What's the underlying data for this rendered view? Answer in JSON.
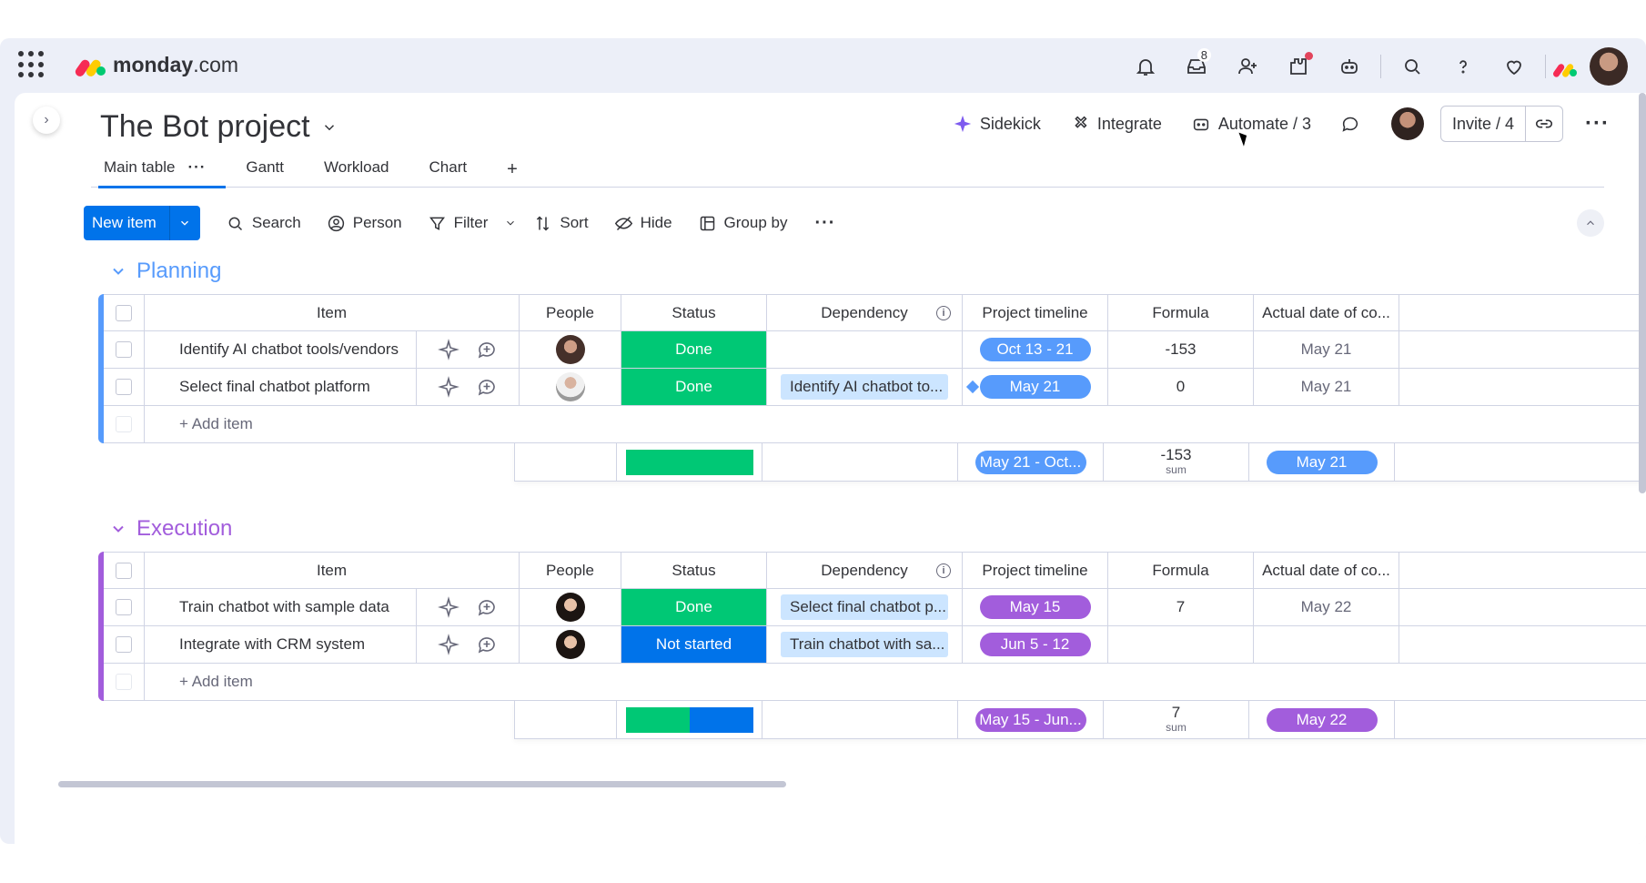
{
  "app": {
    "brand_bold": "monday",
    "brand_light": ".com"
  },
  "topbar": {
    "inbox_count": "8"
  },
  "board": {
    "title": "The Bot project",
    "actions": {
      "sidekick": "Sidekick",
      "integrate": "Integrate",
      "automate": "Automate / 3",
      "invite": "Invite / 4"
    }
  },
  "tabs": [
    {
      "label": "Main table"
    },
    {
      "label": "Gantt"
    },
    {
      "label": "Workload"
    },
    {
      "label": "Chart"
    }
  ],
  "tabs_plus": "+",
  "toolbar": {
    "new_item": "New item",
    "search": "Search",
    "person": "Person",
    "filter": "Filter",
    "sort": "Sort",
    "hide": "Hide",
    "group_by": "Group by"
  },
  "columns": {
    "item": "Item",
    "people": "People",
    "status": "Status",
    "dependency": "Dependency",
    "timeline": "Project timeline",
    "formula": "Formula",
    "actual": "Actual date of co..."
  },
  "colors": {
    "done": "#00c875",
    "not_started": "#0073ea",
    "planning": "#579bfc",
    "execution": "#a25ddc"
  },
  "groups": [
    {
      "name": "Planning",
      "add_item": "+ Add item",
      "rows": [
        {
          "item": "Identify AI chatbot tools/vendors",
          "status": "Done",
          "dependency": "",
          "timeline": "Oct 13 - 21",
          "formula": "-153",
          "actual": "May 21"
        },
        {
          "item": "Select final chatbot platform",
          "status": "Done",
          "dependency": "Identify AI chatbot to...",
          "timeline": "May 21",
          "formula": "0",
          "actual": "May 21"
        }
      ],
      "summary": {
        "timeline": "May 21 - Oct...",
        "formula": "-153",
        "formula_label": "sum",
        "actual": "May 21"
      }
    },
    {
      "name": "Execution",
      "add_item": "+ Add item",
      "rows": [
        {
          "item": "Train chatbot with sample data",
          "status": "Done",
          "dependency": "Select final chatbot p...",
          "timeline": "May 15",
          "formula": "7",
          "actual": "May 22"
        },
        {
          "item": "Integrate with CRM system",
          "status": "Not started",
          "dependency": "Train chatbot with sa...",
          "timeline": "Jun 5 - 12",
          "formula": "",
          "actual": ""
        }
      ],
      "summary": {
        "timeline": "May 15 - Jun...",
        "formula": "7",
        "formula_label": "sum",
        "actual": "May 22"
      }
    }
  ]
}
